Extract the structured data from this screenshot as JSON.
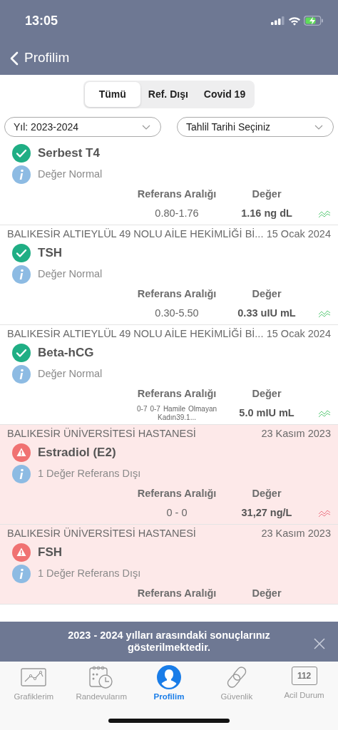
{
  "status_bar": {
    "time": "13:05"
  },
  "nav": {
    "back_label": "Profilim"
  },
  "segments": [
    {
      "label": "Tümü",
      "selected": true
    },
    {
      "label": "Ref. Dışı",
      "selected": false
    },
    {
      "label": "Covid 19",
      "selected": false
    }
  ],
  "filters": [
    {
      "value": "Yıl: 2023-2024"
    },
    {
      "value": "Tahlil Tarihi Seçiniz"
    }
  ],
  "results": [
    {
      "kind": "normal",
      "name": "Serbest T4",
      "message": "Değer Normal",
      "ref_header": "Referans Aralığı",
      "value_header": "Değer",
      "ref_range": "0.80-1.76",
      "value": "1.16 ng dL"
    },
    {
      "kind": "normal",
      "source": "BALIKESİR ALTIEYLÜL 49 NOLU AİLE HEKİMLİĞİ Bİ...",
      "date": "15 Ocak 2024",
      "name": "TSH",
      "message": "Değer Normal",
      "ref_header": "Referans Aralığı",
      "value_header": "Değer",
      "ref_range": "0.30-5.50",
      "value": "0.33 uIU mL"
    },
    {
      "kind": "normal",
      "source": "BALIKESİR ALTIEYLÜL 49 NOLU AİLE HEKİMLİĞİ Bİ...",
      "date": "15 Ocak 2024",
      "name": "Beta-hCG",
      "message": "Değer Normal",
      "ref_header": "Referans Aralığı",
      "value_header": "Değer",
      "ref_range": "0-7 0-7 Hamile Olmayan Kadın39.1...",
      "ref_small": true,
      "value": "5.0 mIU mL"
    },
    {
      "kind": "abnormal",
      "source": "BALIKESİR ÜNİVERSİTESİ HASTANESİ",
      "date": "23 Kasım 2023",
      "name": "Estradiol (E2)",
      "message": "1 Değer Referans Dışı",
      "ref_header": "Referans Aralığı",
      "value_header": "Değer",
      "ref_range": "0 - 0",
      "value": "31,27 ng/L"
    },
    {
      "kind": "abnormal",
      "source": "BALIKESİR ÜNİVERSİTESİ HASTANESİ",
      "date": "23 Kasım 2023",
      "name": "FSH",
      "message": "1 Değer Referans Dışı",
      "ref_header": "Referans Aralığı",
      "value_header": "Değer"
    }
  ],
  "banner": {
    "text": "2023 - 2024 yılları arasındaki sonuçlarınız gösterilmektedir."
  },
  "tab_bar": [
    {
      "kind": "chart",
      "label": "Grafiklerim",
      "selected": false
    },
    {
      "kind": "calendar",
      "label": "Randevularım",
      "selected": false
    },
    {
      "kind": "person",
      "label": "Profilim",
      "selected": true
    },
    {
      "kind": "link",
      "label": "Güvenlik",
      "selected": false
    },
    {
      "kind": "emergency",
      "label": "Acil Durum",
      "badge": "112",
      "selected": false
    }
  ]
}
